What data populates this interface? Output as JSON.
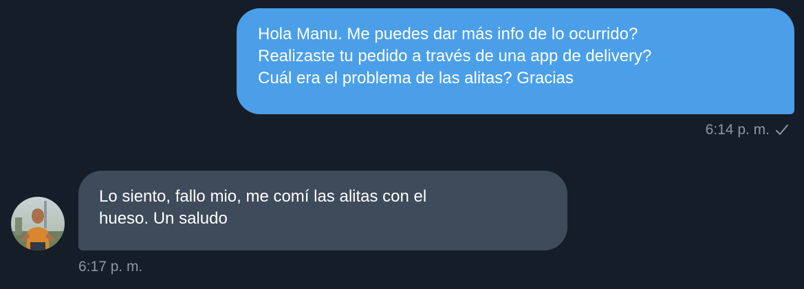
{
  "conversation": {
    "messages": [
      {
        "direction": "outgoing",
        "text": "Hola Manu. Me puedes dar más info de lo ocurrido?\nRealizaste tu pedido a través de una app de delivery?\nCuál era el problema de las alitas? Gracias",
        "time": "6:14 p. m.",
        "status_icon": "checkmark-icon"
      },
      {
        "direction": "incoming",
        "text": "Lo siento, fallo mio, me comí las alitas con el\nhueso. Un saludo",
        "time": "6:17 p. m.",
        "avatar_icon": "user-avatar"
      }
    ]
  },
  "colors": {
    "background": "#151d28",
    "outgoing_bubble": "#4a9fe8",
    "incoming_bubble": "#3e4b5a",
    "timestamp": "#8b98a5"
  }
}
